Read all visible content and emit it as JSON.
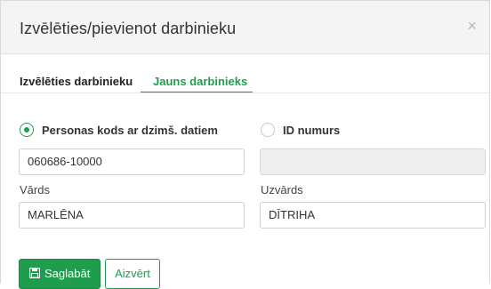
{
  "dialog": {
    "title": "Izvēlēties/pievienot darbinieku",
    "close_symbol": "×"
  },
  "tabs": [
    {
      "label": "Izvēlēties darbinieku",
      "active": false
    },
    {
      "label": "Jauns darbinieks",
      "active": true
    }
  ],
  "identifier": {
    "options": [
      {
        "label": "Personas kods ar dzimš. datiem",
        "selected": true
      },
      {
        "label": "ID numurs",
        "selected": false
      }
    ]
  },
  "fields": {
    "personal_code_value": "060686-10000",
    "id_number_value": "",
    "first_name_label": "Vārds",
    "first_name_value": "MARLĒNA",
    "last_name_label": "Uzvārds",
    "last_name_value": "DĪTRIHA"
  },
  "actions": {
    "save_label": "Saglabāt",
    "close_label": "Aizvērt"
  },
  "colors": {
    "accent": "#1e9e4c",
    "header_bg": "#f4f4f4",
    "disabled_field_bg": "#eeeeee"
  },
  "icons": {
    "save": "floppy-disk-icon",
    "close": "close-icon"
  }
}
